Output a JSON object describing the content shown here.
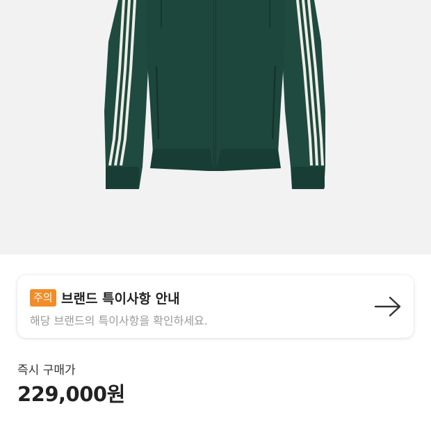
{
  "notice": {
    "badge": "주의",
    "title": "브랜드 특이사항 안내",
    "description": "해당 브랜드의 특이사항을 확인하세요.",
    "arrow_icon": "arrow-right-icon",
    "badge_color": "#f28c28"
  },
  "price": {
    "label": "즉시 구매가",
    "value": "229,000원"
  },
  "colors": {
    "image_background": "#f2f2f2",
    "jacket": "#1f4a40",
    "stripes": "#efeee6"
  }
}
